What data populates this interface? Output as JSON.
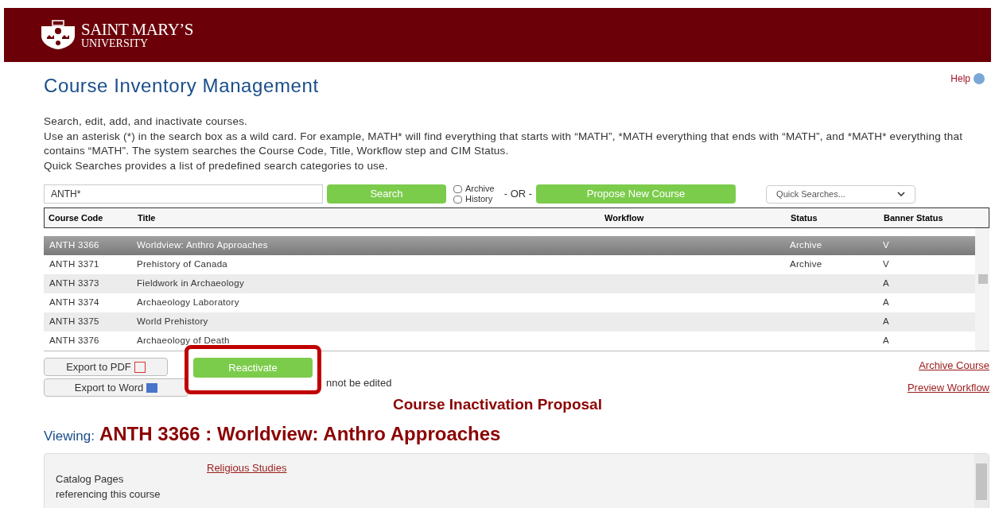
{
  "header": {
    "logo_line1": "SAINT MARY’S",
    "logo_line2": "UNIVERSITY"
  },
  "page": {
    "title": "Course Inventory Management",
    "help": "Help"
  },
  "intro": [
    "Search, edit, add, and inactivate courses.",
    "Use an asterisk (*) in the search box as a wild card. For example, MATH* will find everything that starts with “MATH”, *MATH everything that ends with “MATH”, and *MATH* everything that contains “MATH”. The system searches the Course Code, Title, Workflow step and CIM Status.",
    "Quick Searches provides a list of predefined search categories to use."
  ],
  "search": {
    "value": "ANTH*",
    "button": "Search",
    "options": [
      {
        "label": "Archive",
        "checked": false
      },
      {
        "label": "History",
        "checked": false
      }
    ],
    "or": "- OR -",
    "propose": "Propose New Course",
    "quick": "Quick Searches..."
  },
  "table": {
    "columns": [
      "Course Code",
      "Title",
      "Workflow",
      "Status",
      "Banner Status"
    ],
    "rows": [
      {
        "code": "ANTH 3366",
        "title": "Worldview: Anthro Approaches",
        "workflow": "",
        "status": "Archive",
        "banner": "V",
        "selected": true
      },
      {
        "code": "ANTH 3371",
        "title": "Prehistory of Canada",
        "workflow": "",
        "status": "Archive",
        "banner": "V",
        "selected": false
      },
      {
        "code": "ANTH 3373",
        "title": "Fieldwork in Archaeology",
        "workflow": "",
        "status": "",
        "banner": "A",
        "selected": false
      },
      {
        "code": "ANTH 3374",
        "title": "Archaeology Laboratory",
        "workflow": "",
        "status": "",
        "banner": "A",
        "selected": false
      },
      {
        "code": "ANTH 3375",
        "title": "World Prehistory",
        "workflow": "",
        "status": "",
        "banner": "A",
        "selected": false
      },
      {
        "code": "ANTH 3376",
        "title": "Archaeology of Death",
        "workflow": "",
        "status": "",
        "banner": "A",
        "selected": false
      }
    ]
  },
  "actions": {
    "export_pdf": "Export to PDF",
    "export_word": "Export to Word",
    "reactivate": "Reactivate",
    "note": "nnot be edited",
    "archive_link": "Archive Course",
    "preview_link": "Preview Workflow"
  },
  "proposal": {
    "heading": "Course Inactivation Proposal",
    "viewing_label": "Viewing:",
    "viewing_course": "ANTH 3366 : Worldview: Anthro Approaches"
  },
  "details": {
    "label": "Catalog Pages referencing this course",
    "link": "Religious Studies"
  }
}
